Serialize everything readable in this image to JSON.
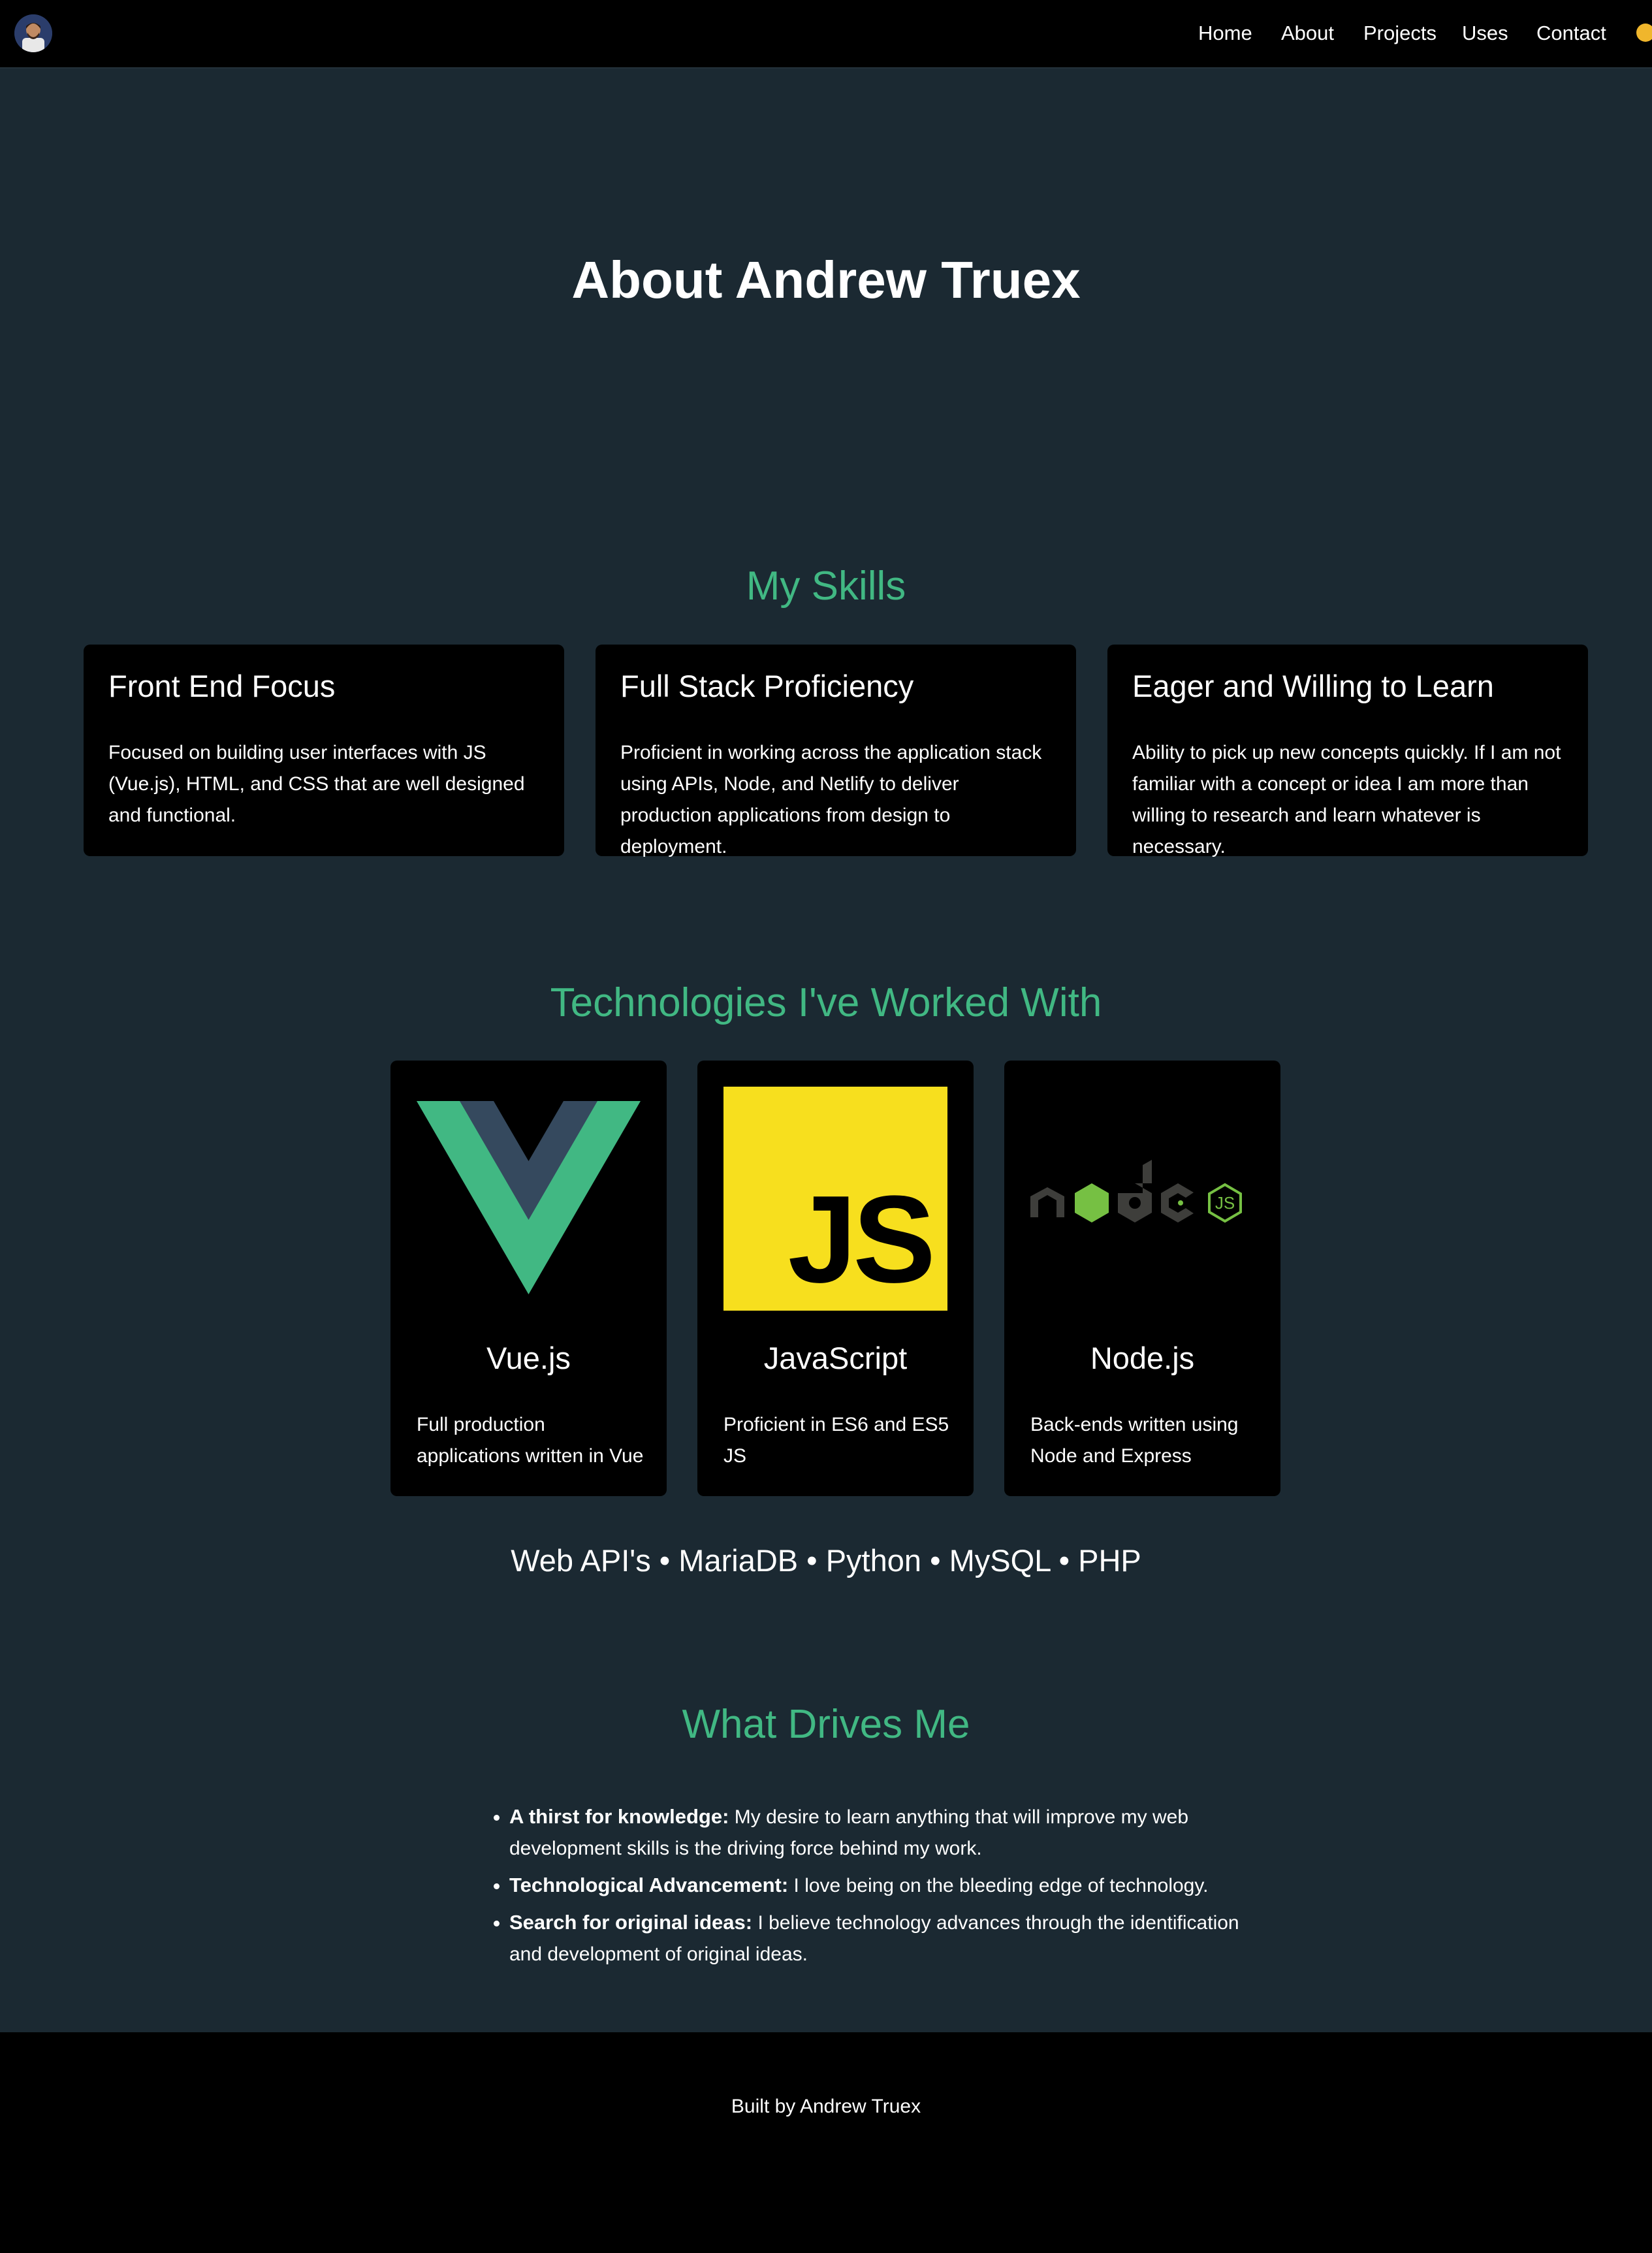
{
  "nav": {
    "links": [
      "Home",
      "About",
      "Projects",
      "Uses",
      "Contact"
    ]
  },
  "page": {
    "title": "About Andrew Truex"
  },
  "skills": {
    "heading": "My Skills",
    "cards": [
      {
        "title": "Front End Focus",
        "text": "Focused on building user interfaces with JS (Vue.js), HTML, and CSS that are well designed and functional."
      },
      {
        "title": "Full Stack Proficiency",
        "text": "Proficient in working across the application stack using APIs, Node, and Netlify to deliver production applications from design to deployment."
      },
      {
        "title": "Eager and Willing to Learn",
        "text": "Ability to pick up new concepts quickly. If I am not familiar with a concept or idea I am more than willing to research and learn whatever is necessary."
      }
    ]
  },
  "tech": {
    "heading": "Technologies I've Worked With",
    "cards": [
      {
        "title": "Vue.js",
        "text": "Full production applications written in Vue",
        "logo": "vue-logo"
      },
      {
        "title": "JavaScript",
        "text": "Proficient in ES6 and ES5 JS",
        "logo": "javascript-logo",
        "logo_text": "JS"
      },
      {
        "title": "Node.js",
        "text": "Back-ends written using Node and Express",
        "logo": "nodejs-logo",
        "logo_text": "JS"
      }
    ],
    "others": "Web API's • MariaDB • Python • MySQL • PHP"
  },
  "drives": {
    "heading": "What Drives Me",
    "items": [
      {
        "label": "A thirst for knowledge:",
        "text": " My desire to learn anything that will improve my web development skills is the driving force behind my work."
      },
      {
        "label": "Technological Advancement:",
        "text": " I love being on the bleeding edge of technology."
      },
      {
        "label": "Search for original ideas:",
        "text": " I believe technology advances through the identification and development of original ideas."
      }
    ]
  },
  "footer": {
    "text": "Built by Andrew Truex"
  },
  "colors": {
    "accent": "#41b883",
    "background": "#1b2932",
    "card": "#000000",
    "vue_dark": "#35495e",
    "js_yellow": "#f7df1e",
    "node_green": "#76c043"
  },
  "icons": {
    "avatar": "avatar-icon",
    "theme_toggle": "sun-icon"
  }
}
